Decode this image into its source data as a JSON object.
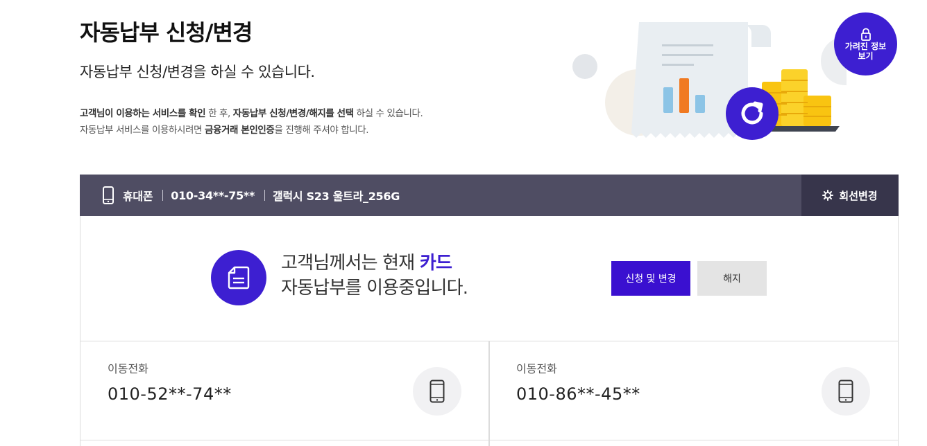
{
  "header": {
    "title": "자동납부 신청/변경",
    "subtitle": "자동납부 신청/변경을 하실 수 있습니다.",
    "desc_line1": {
      "bold1": "고객님이 이용하는 서비스를 확인",
      "text1": " 한 후, ",
      "bold2": "자동납부 신청/변경/해지를 선택",
      "text2": " 하실 수 있습니다."
    },
    "desc_line2": {
      "text1": "자동납부 서비스를 이용하시려면 ",
      "bold1": "금융거래 본인인증",
      "text2": "을 진행해 주셔야 합니다."
    }
  },
  "hidden_info_button": {
    "label": "가려진 정보보기",
    "icon": "lock-icon"
  },
  "line_bar": {
    "type": "휴대폰",
    "number": "010-34**-75**",
    "device": "갤럭시 S23 울트라_256G",
    "change_label": "회선변경"
  },
  "status": {
    "text_before": "고객님께서는 현재 ",
    "highlight": "카드",
    "text_line2": "자동납부를 이용중입니다.",
    "apply_label": "신청 및 변경",
    "cancel_label": "해지"
  },
  "lines": [
    {
      "label": "이동전화",
      "number": "010-52**-74**"
    },
    {
      "label": "이동전화",
      "number": "010-86**-45**"
    }
  ],
  "colors": {
    "accent": "#3d1fd1",
    "bar": "#4f4d63",
    "bar_dark": "#37354b"
  }
}
